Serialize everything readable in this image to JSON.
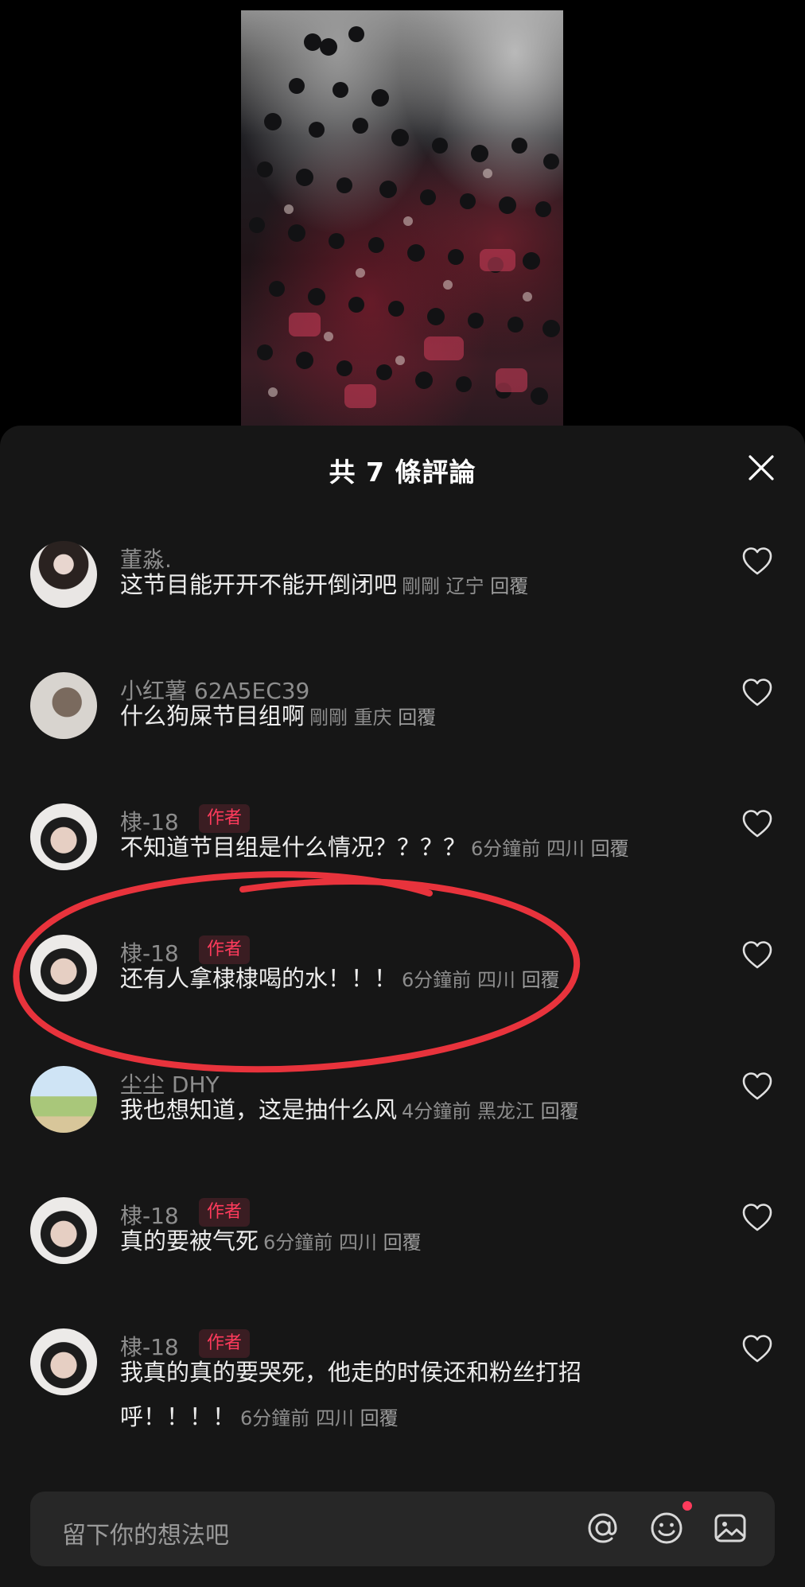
{
  "video": {
    "description_icon": "video-thumbnail"
  },
  "sheet": {
    "title": "共 7 條評論",
    "close_icon": "close-icon"
  },
  "comments": [
    {
      "user": "董淼.",
      "author_tag": "",
      "text": "这节目能开开不能开倒闭吧",
      "time": "剛剛",
      "location": "辽宁",
      "reply": "回覆"
    },
    {
      "user": "小红薯 62A5EC39",
      "author_tag": "",
      "text": "什么狗屎节目组啊",
      "time": "剛剛",
      "location": "重庆",
      "reply": "回覆"
    },
    {
      "user": "棣-18",
      "author_tag": "作者",
      "text": "不知道节目组是什么情况？？？？",
      "time": "6分鐘前",
      "location": "四川",
      "reply": "回覆"
    },
    {
      "user": "棣-18",
      "author_tag": "作者",
      "text": "还有人拿棣棣喝的水！！！",
      "time": "6分鐘前",
      "location": "四川",
      "reply": "回覆"
    },
    {
      "user": "尘尘 DHY",
      "author_tag": "",
      "text": "我也想知道，这是抽什么风",
      "time": "4分鐘前",
      "location": "黑龙江",
      "reply": "回覆"
    },
    {
      "user": "棣-18",
      "author_tag": "作者",
      "text": "真的要被气死",
      "time": "6分鐘前",
      "location": "四川",
      "reply": "回覆"
    },
    {
      "user": "棣-18",
      "author_tag": "作者",
      "text": "我真的真的要哭死，他走的时侯还和粉丝打招呼！！！！",
      "time": "6分鐘前",
      "location": "四川",
      "reply": "回覆"
    }
  ],
  "input": {
    "placeholder": "留下你的想法吧"
  },
  "icons": [
    "at-icon",
    "emoji-icon",
    "image-icon",
    "heart-icon"
  ],
  "colors": {
    "sheet_bg": "#161616",
    "author_tag": "#ff3b5c",
    "annotation": "#e8333c"
  }
}
